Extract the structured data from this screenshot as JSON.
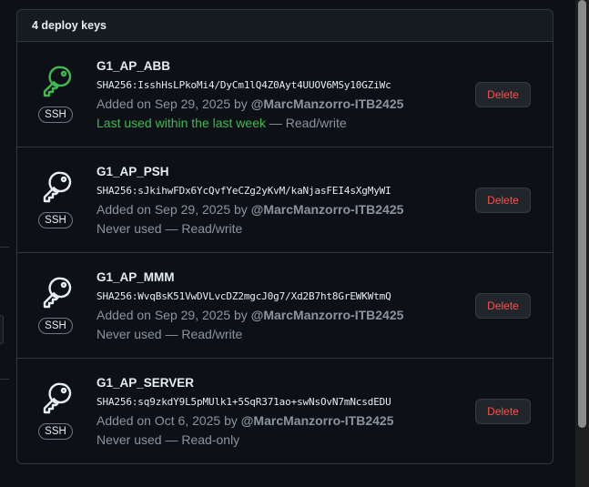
{
  "header": {
    "title": "4 deploy keys"
  },
  "colors": {
    "recent_key_icon": "#3fb950",
    "default_key_icon": "#e6edf3",
    "danger": "#f85149"
  },
  "keys": [
    {
      "title": "G1_AP_ABB",
      "fingerprint": "SHA256:IsshHsLPkoMi4/DyCm1lQ4Z0Ayt4UUOV6MSy10GZiWc",
      "added_prefix": "Added on Sep 29, 2025 by ",
      "author": "@MarcManzorro-ITB2425",
      "usage_recent": "Last used within the last week",
      "usage": " — Read/write",
      "badge": "SSH",
      "delete_label": "Delete",
      "icon": "key-icon-green"
    },
    {
      "title": "G1_AP_PSH",
      "fingerprint": "SHA256:sJkihwFDx6YcQvfYeCZg2yKvM/kaNjasFEI4sXgMyWI",
      "added_prefix": "Added on Sep 29, 2025 by ",
      "author": "@MarcManzorro-ITB2425",
      "usage_recent": "",
      "usage": "Never used — Read/write",
      "badge": "SSH",
      "delete_label": "Delete",
      "icon": "key-icon"
    },
    {
      "title": "G1_AP_MMM",
      "fingerprint": "SHA256:WvqBsK51VwDVLvcDZ2mgcJ0g7/Xd2B7ht8GrEWKWtmQ",
      "added_prefix": "Added on Sep 29, 2025 by ",
      "author": "@MarcManzorro-ITB2425",
      "usage_recent": "",
      "usage": "Never used — Read/write",
      "badge": "SSH",
      "delete_label": "Delete",
      "icon": "key-icon"
    },
    {
      "title": "G1_AP_SERVER",
      "fingerprint": "SHA256:sq9zkdY9L5pMUlk1+5SqR371ao+swNsOvN7mNcsdEDU",
      "added_prefix": "Added on Oct 6, 2025 by ",
      "author": "@MarcManzorro-ITB2425",
      "usage_recent": "",
      "usage": "Never used — Read-only",
      "badge": "SSH",
      "delete_label": "Delete",
      "icon": "key-icon"
    }
  ]
}
